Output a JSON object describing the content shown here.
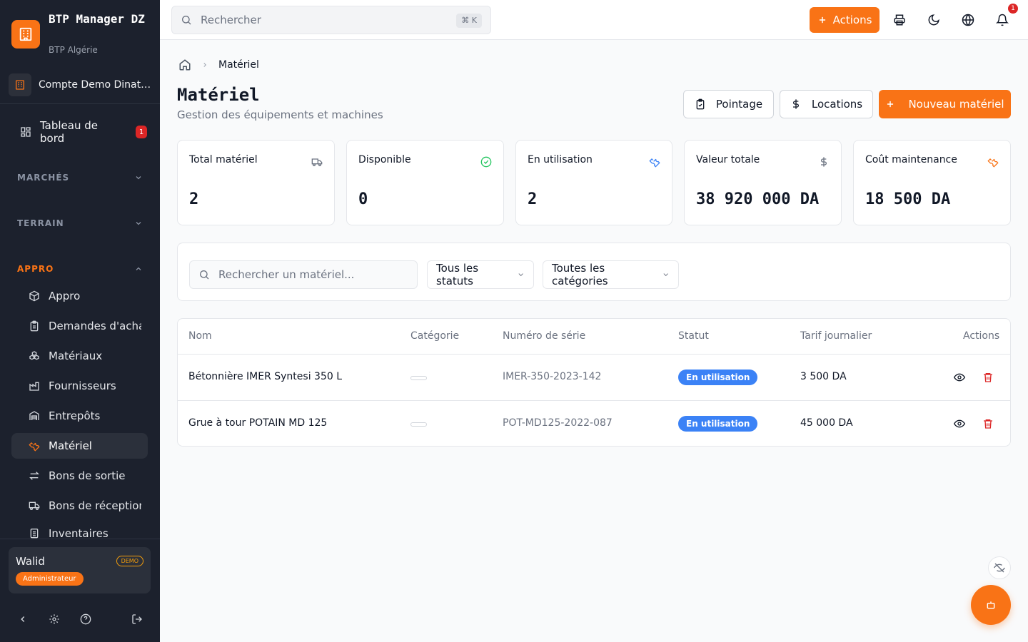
{
  "colors": {
    "accent": "#f97316",
    "sidebar_bg": "#1c212d",
    "status_blue": "#3b82f6",
    "danger": "#dc2626"
  },
  "brand": {
    "name": "BTP Manager DZ",
    "subtitle": "BTP Algérie",
    "icon": "building-icon"
  },
  "account": {
    "label": "Compte Demo Dinatek",
    "icon": "building-icon"
  },
  "sidebar": {
    "dashboard": {
      "label": "Tableau de bord",
      "badge": "1",
      "icon": "layout-grid-icon"
    },
    "sections": [
      {
        "label": "MARCHÉS",
        "expanded": false
      },
      {
        "label": "TERRAIN",
        "expanded": false
      },
      {
        "label": "APPRO",
        "expanded": true
      }
    ],
    "items": [
      {
        "label": "Appro",
        "icon": "package-icon"
      },
      {
        "label": "Demandes d'achat",
        "icon": "clipboard-icon"
      },
      {
        "label": "Matériaux",
        "icon": "boxes-icon"
      },
      {
        "label": "Fournisseurs",
        "icon": "factory-icon"
      },
      {
        "label": "Entrepôts",
        "icon": "warehouse-icon"
      },
      {
        "label": "Matériel",
        "icon": "wrench-icon",
        "selected": true
      },
      {
        "label": "Bons de sortie",
        "icon": "arrows-left-right-icon"
      },
      {
        "label": "Bons de réception",
        "icon": "truck-icon"
      },
      {
        "label": "Inventaires",
        "icon": "clipboard-list-icon"
      }
    ]
  },
  "user": {
    "name": "Walid",
    "demo_badge": "DEMO",
    "role": "Administrateur"
  },
  "bottom_icons": [
    "chevron-left-icon",
    "settings-icon",
    "help-icon",
    "logout-icon"
  ],
  "topbar": {
    "search_placeholder": "Rechercher",
    "shortcut": "⌘ K",
    "actions_label": "Actions",
    "notification_count": "1"
  },
  "breadcrumb": {
    "home_icon": "home-icon",
    "current": "Matériel"
  },
  "page": {
    "title": "Matériel",
    "subtitle": "Gestion des équipements et machines",
    "buttons": {
      "pointage": "Pointage",
      "locations": "Locations",
      "new": "Nouveau matériel"
    }
  },
  "stats": [
    {
      "label": "Total matériel",
      "value": "2",
      "icon": "truck-icon"
    },
    {
      "label": "Disponible",
      "value": "0",
      "icon": "check-circle-icon"
    },
    {
      "label": "En utilisation",
      "value": "2",
      "icon": "wrench-icon"
    },
    {
      "label": "Valeur totale",
      "value": "38 920 000 DA",
      "icon": "dollar-icon"
    },
    {
      "label": "Coût maintenance",
      "value": "18 500 DA",
      "icon": "wrench-icon"
    }
  ],
  "filters": {
    "search_placeholder": "Rechercher un matériel...",
    "status_select": "Tous les statuts",
    "category_select": "Toutes les catégories"
  },
  "table": {
    "headers": [
      "Nom",
      "Catégorie",
      "Numéro de série",
      "Statut",
      "Tarif journalier",
      "Actions"
    ],
    "rows": [
      {
        "name": "Bétonnière IMER Syntesi 350 L",
        "category": "",
        "serial": "IMER-350-2023-142",
        "status": "En utilisation",
        "rate": "3 500 DA"
      },
      {
        "name": "Grue à tour POTAIN MD 125",
        "category": "",
        "serial": "POT-MD125-2022-087",
        "status": "En utilisation",
        "rate": "45 000 DA"
      }
    ]
  }
}
